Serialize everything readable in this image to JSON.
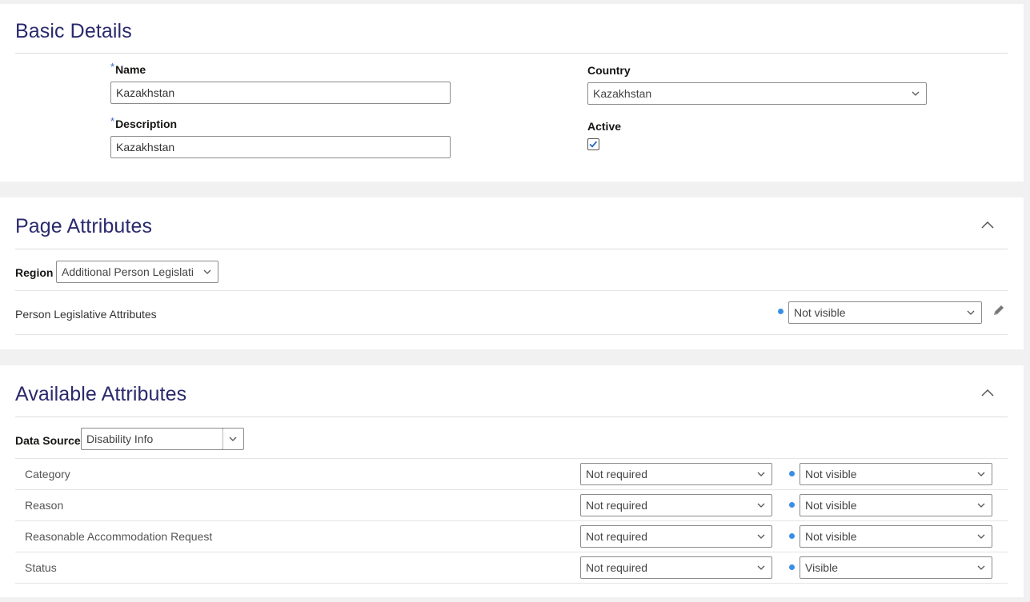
{
  "basic_details": {
    "title": "Basic Details",
    "name_label": "Name",
    "name_value": "Kazakhstan",
    "description_label": "Description",
    "description_value": "Kazakhstan",
    "country_label": "Country",
    "country_value": "Kazakhstan",
    "active_label": "Active",
    "active_checked": true
  },
  "page_attributes": {
    "title": "Page Attributes",
    "region_label": "Region",
    "region_value": "Additional Person Legislati",
    "row_label": "Person Legislative Attributes",
    "row_visibility": "Not visible"
  },
  "available_attributes": {
    "title": "Available Attributes",
    "data_source_label": "Data Source",
    "data_source_value": "Disability Info",
    "rows": [
      {
        "label": "Category",
        "required": "Not required",
        "visibility": "Not visible"
      },
      {
        "label": "Reason",
        "required": "Not required",
        "visibility": "Not visible"
      },
      {
        "label": "Reasonable Accommodation Request",
        "required": "Not required",
        "visibility": "Not visible"
      },
      {
        "label": "Status",
        "required": "Not required",
        "visibility": "Visible"
      }
    ]
  },
  "colors": {
    "title": "#2a2a6e",
    "required_marker": "#3a6fc4",
    "status_dot": "#3a8ee6",
    "checkbox_check": "#1f5fbf"
  },
  "icons": {
    "dropdown": "chevron-down-icon",
    "collapse": "chevron-up-icon",
    "edit": "pencil-icon",
    "check": "checkmark-icon"
  },
  "markers": {
    "required": "*"
  }
}
